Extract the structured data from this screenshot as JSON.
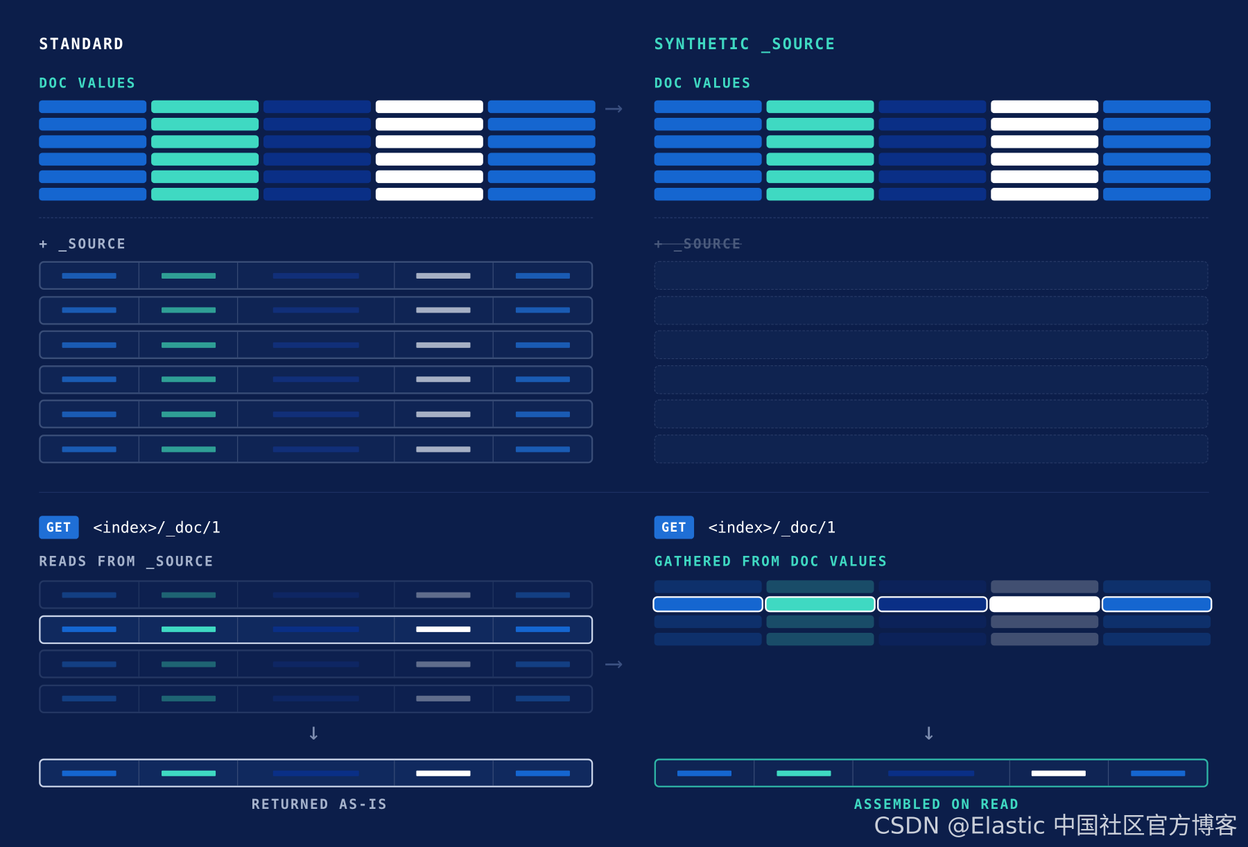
{
  "left": {
    "title": "STANDARD",
    "doc_values_label": "DOC VALUES",
    "source_label": "+ _SOURCE",
    "get_method": "GET",
    "get_path": "<index>/_doc/1",
    "read_label": "READS FROM _SOURCE",
    "result_label": "RETURNED AS-IS"
  },
  "right": {
    "title": "SYNTHETIC _SOURCE",
    "doc_values_label": "DOC VALUES",
    "source_label": "+ _SOURCE",
    "get_method": "GET",
    "get_path": "<index>/_doc/1",
    "read_label": "GATHERED FROM DOC VALUES",
    "result_label": "ASSEMBLED ON READ"
  },
  "column_colors": [
    "#1566d0",
    "#3fd9c2",
    "#0a2f86",
    "#ffffff",
    "#1566d0"
  ],
  "source_mark_colors": [
    "#1a5bb3",
    "#2f9f95",
    "#112f79",
    "#a6b0c4",
    "#1a5bb3"
  ],
  "doc_value_rows": 6,
  "source_rows": 6,
  "watermark": "CSDN @Elastic 中国社区官方博客"
}
